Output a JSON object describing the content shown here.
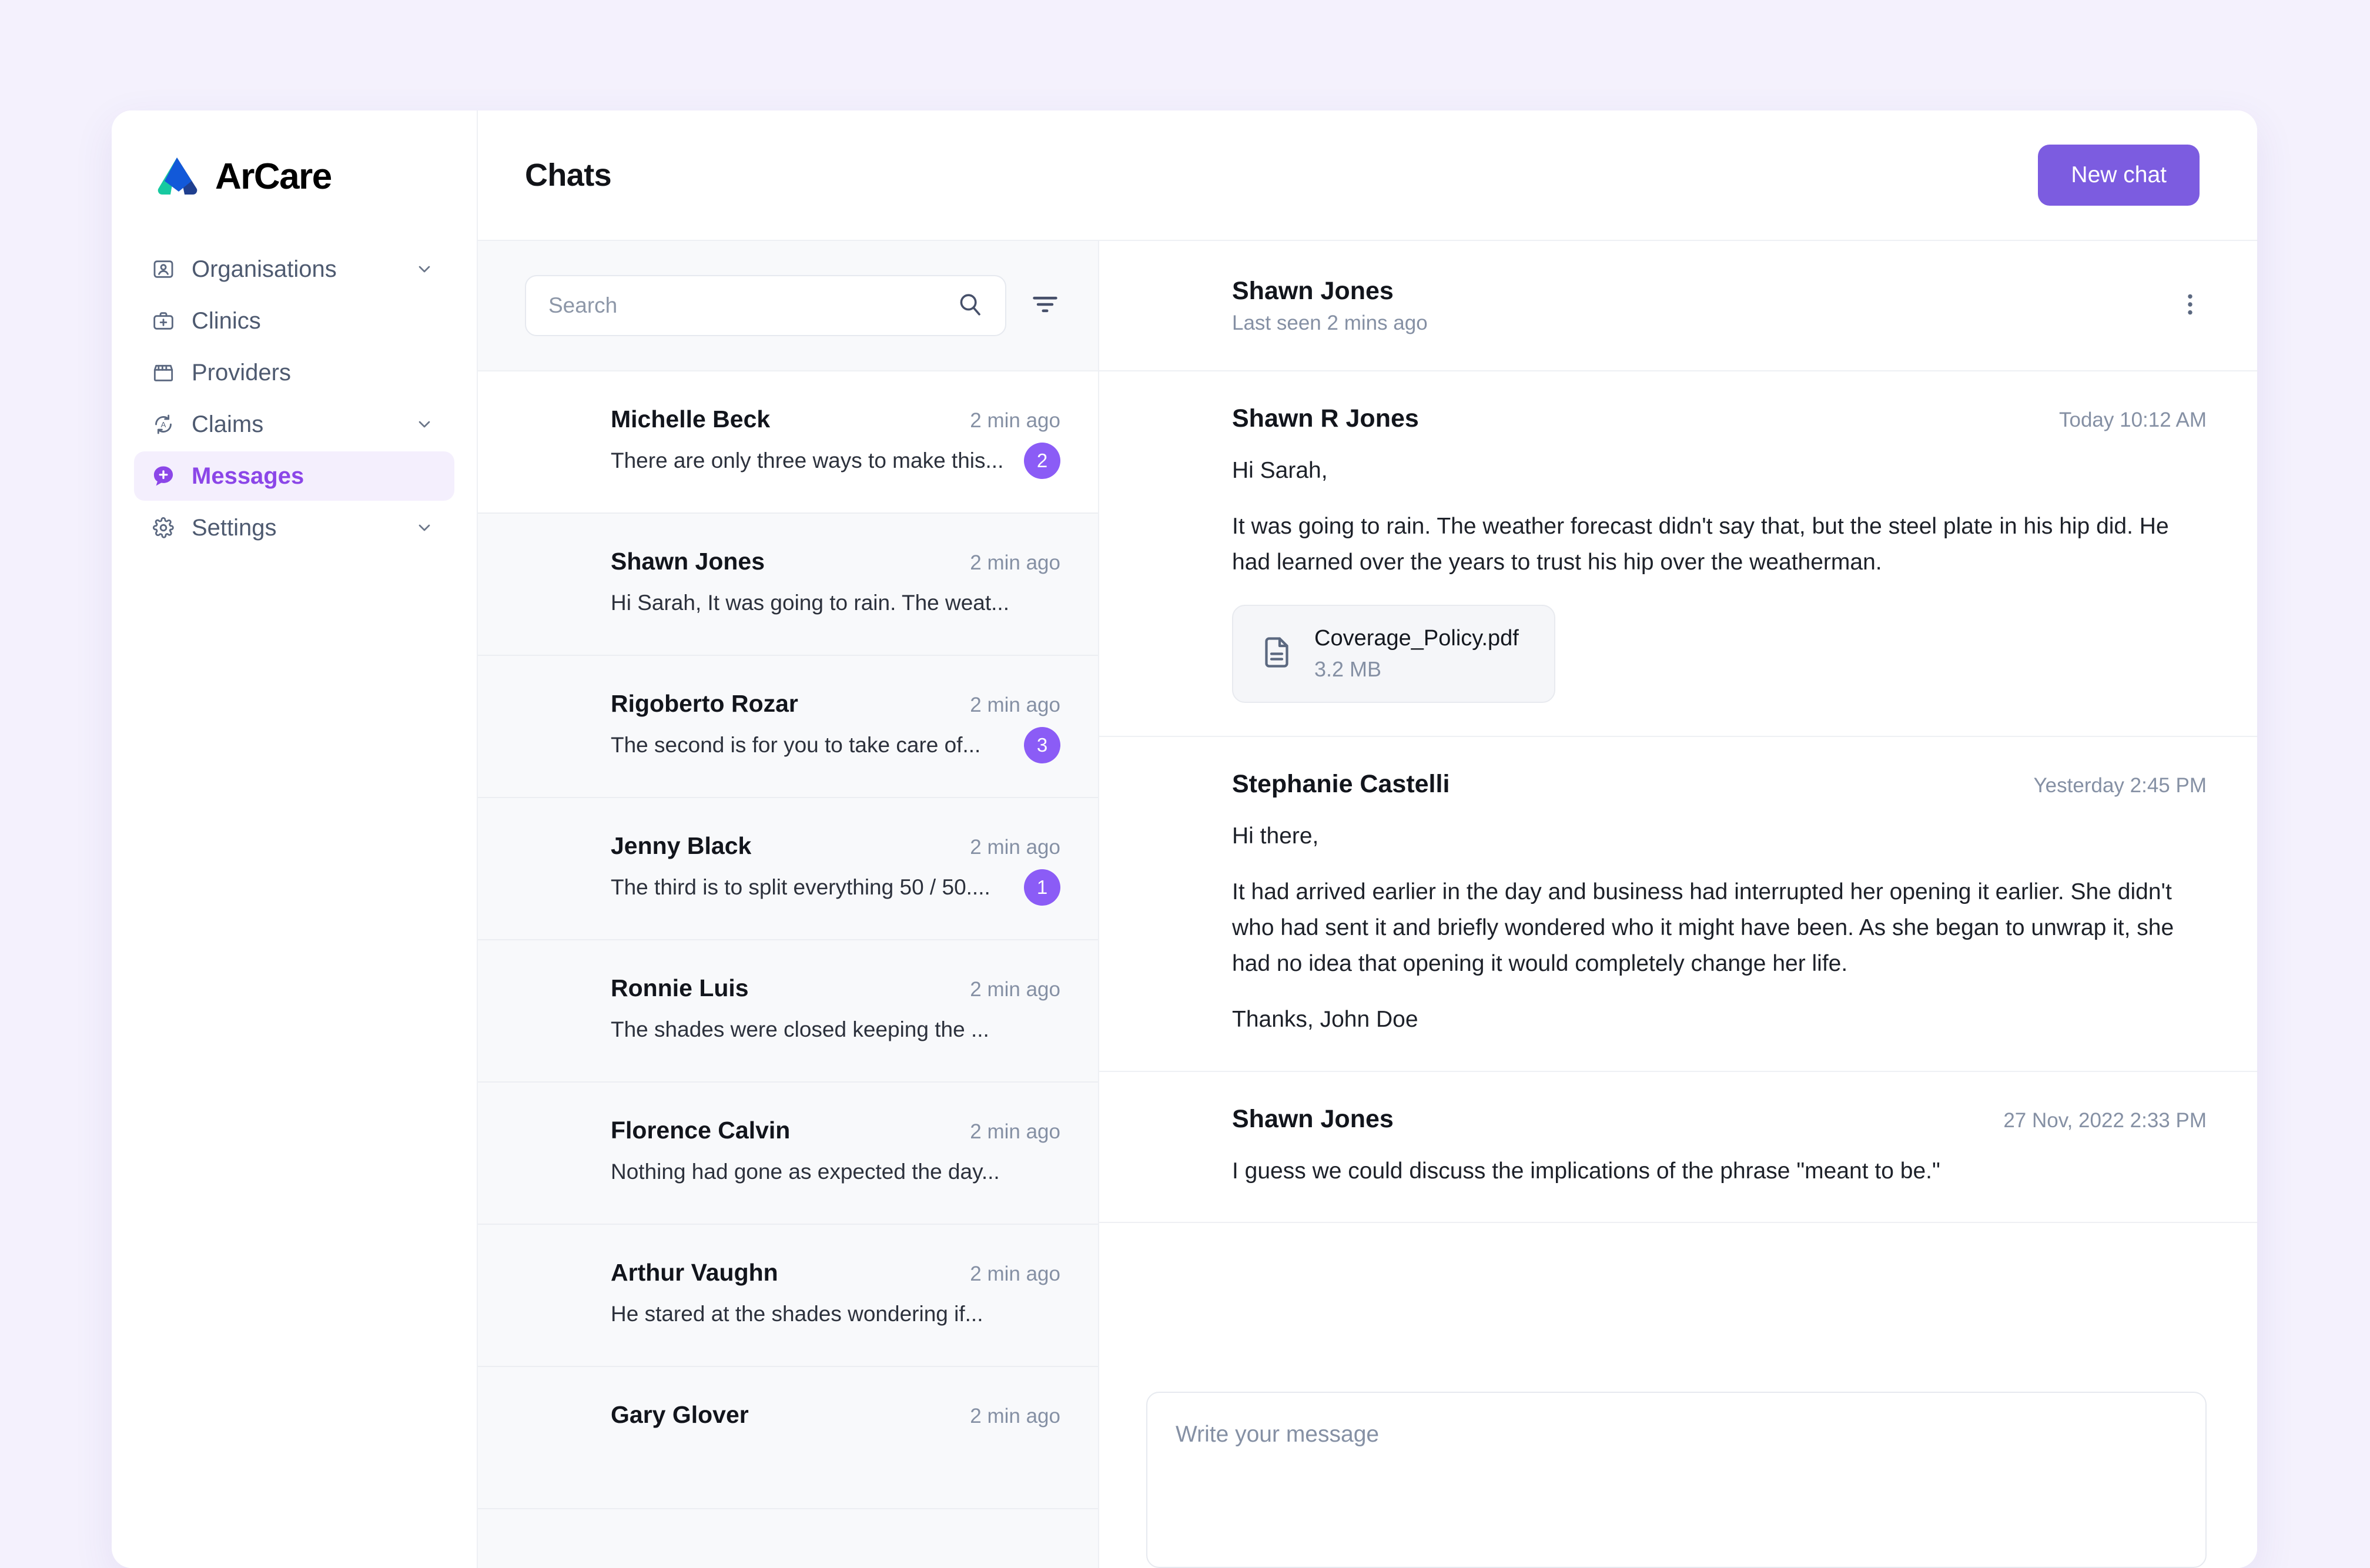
{
  "brand": {
    "name": "ArCare"
  },
  "sidebar": {
    "items": [
      {
        "label": "Organisations",
        "icon": "user-card-icon",
        "chevron": true,
        "active": false
      },
      {
        "label": "Clinics",
        "icon": "medical-bag-icon",
        "chevron": false,
        "active": false
      },
      {
        "label": "Providers",
        "icon": "storefront-icon",
        "chevron": false,
        "active": false
      },
      {
        "label": "Claims",
        "icon": "claims-refresh-icon",
        "chevron": true,
        "active": false
      },
      {
        "label": "Messages",
        "icon": "message-plus-icon",
        "chevron": false,
        "active": true
      },
      {
        "label": "Settings",
        "icon": "gear-icon",
        "chevron": true,
        "active": false
      }
    ]
  },
  "topbar": {
    "title": "Chats",
    "new_chat_label": "New chat"
  },
  "search": {
    "placeholder": "Search",
    "value": ""
  },
  "chat_list": [
    {
      "name": "Michelle Beck",
      "time": "2 min ago",
      "preview": "There are only three ways to make this...",
      "badge": "2",
      "selected": true,
      "avatar": {
        "bg": "#1d1b22",
        "hair": "#15131a",
        "skin": "#d9a88c",
        "body": "#c3cbd8"
      }
    },
    {
      "name": "Shawn Jones",
      "time": "2 min ago",
      "preview": "Hi Sarah, It was going to rain. The weat...",
      "badge": "",
      "selected": false,
      "avatar": {
        "bg": "#cfd4de",
        "hair": "#3b2a21",
        "skin": "#e0b497",
        "body": "#2d3138"
      }
    },
    {
      "name": "Rigoberto Rozar",
      "time": "2 min ago",
      "preview": "The second is for you to take care of...",
      "badge": "3",
      "selected": false,
      "avatar": {
        "bg": "#efe9e3",
        "hair": "#50382a",
        "skin": "#e4b593",
        "body": "#1b1b1d"
      }
    },
    {
      "name": "Jenny Black",
      "time": "2 min ago",
      "preview": "The third is to split everything 50 / 50....",
      "badge": "1",
      "selected": false,
      "avatar": {
        "bg": "#f1eeeb",
        "hair": "#23180f",
        "skin": "#e8bb9a",
        "body": "#f3f4f6"
      }
    },
    {
      "name": "Ronnie Luis",
      "time": "2 min ago",
      "preview": "The shades were closed keeping the ...",
      "badge": "",
      "selected": false,
      "avatar": {
        "bg": "#a9aaac",
        "hair": "#8d6a46",
        "skin": "#e6bb9b",
        "body": "#4a5564"
      }
    },
    {
      "name": "Florence Calvin",
      "time": "2 min ago",
      "preview": "Nothing had gone as expected the day...",
      "badge": "",
      "selected": false,
      "avatar": {
        "bg": "#dfe4e0",
        "hair": "#1c1410",
        "skin": "#d79e7b",
        "body": "#b79263"
      }
    },
    {
      "name": "Arthur Vaughn",
      "time": "2 min ago",
      "preview": "He stared at the shades wondering if...",
      "badge": "",
      "selected": false,
      "avatar": {
        "bg": "#f0eeea",
        "hair": "#4a3325",
        "skin": "#e2b795",
        "body": "#27354c"
      }
    },
    {
      "name": "Gary Glover",
      "time": "2 min ago",
      "preview": "",
      "badge": "",
      "selected": false,
      "avatar": {
        "bg": "#d9d9d6",
        "hair": "#c2a06a",
        "skin": "#e3bb9b",
        "body": "#5a6170"
      }
    }
  ],
  "conversation": {
    "peer_name": "Shawn Jones",
    "peer_status": "Last seen 2 mins ago",
    "menu_icon": "kebab-menu-icon",
    "messages": [
      {
        "author": "Shawn R Jones",
        "time": "Today 10:12 AM",
        "paragraphs": [
          "Hi Sarah,",
          "It was going to rain. The weather forecast didn't say that, but the steel plate in his hip did. He had learned over the years to trust his hip over the weatherman."
        ],
        "attachment": {
          "name": "Coverage_Policy.pdf",
          "size": "3.2 MB",
          "icon": "document-icon"
        },
        "avatar": {
          "bg": "#cfd4de",
          "hair": "#3b2a21",
          "skin": "#e0b497",
          "body": "#2d3138"
        }
      },
      {
        "author": "Stephanie Castelli",
        "time": "Yesterday 2:45 PM",
        "paragraphs": [
          "Hi there,",
          "It had arrived earlier in the day and business had interrupted her opening it earlier. She didn't who had sent it and briefly wondered who it might have been. As she began to unwrap it, she had no idea that opening it would completely change her life.",
          "Thanks, John Doe"
        ],
        "attachment": null,
        "avatar": {
          "bg": "#b9bec4",
          "hair": "#d6b172",
          "skin": "#edc3a3",
          "body": "#1c1c20"
        }
      },
      {
        "author": "Shawn Jones",
        "time": "27 Nov, 2022 2:33 PM",
        "paragraphs": [
          "I guess we could discuss the implications of the phrase \"meant to be.\""
        ],
        "attachment": null,
        "avatar": {
          "bg": "#cfd4de",
          "hair": "#3b2a21",
          "skin": "#e0b497",
          "body": "#2d3138"
        }
      }
    ]
  },
  "composer": {
    "placeholder": "Write your message",
    "value": ""
  },
  "colors": {
    "accent": "#7c5ce0",
    "badge": "#8b5cf6",
    "active_nav_bg": "#f4effd",
    "active_nav_text": "#8b46e8",
    "page_bg": "#f4f1fd",
    "list_bg": "#f8f9fb",
    "border": "#eef0f4",
    "muted_text": "#8590a4",
    "logo_teal": "#17c9a0",
    "logo_blue": "#1259d9",
    "logo_navy": "#1f3f8f"
  }
}
